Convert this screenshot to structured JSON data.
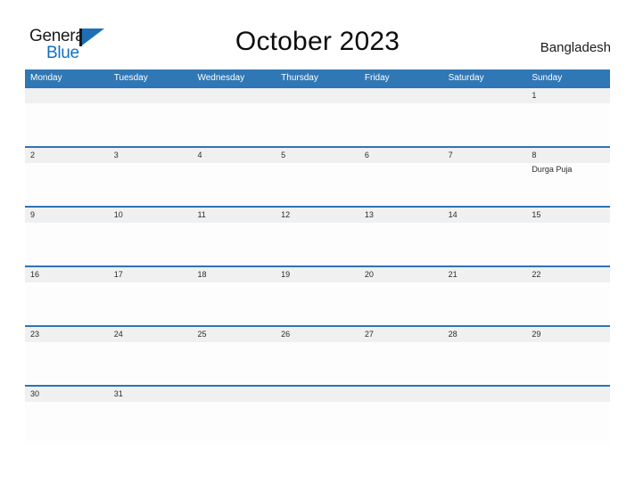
{
  "brand": {
    "name_top": "General",
    "name_bottom": "Blue",
    "accent_color": "#1f6fb5",
    "text_color": "#1b1b1b",
    "blue_text_color": "#1270c0"
  },
  "header": {
    "title": "October 2023",
    "country": "Bangladesh"
  },
  "colors": {
    "header_blue": "#3077b5",
    "row_divider_blue": "#2e74b5",
    "day_band_gray": "#f0f0f0",
    "page_background": "#ffffff",
    "cell_background": "#fdfdfd"
  },
  "calendar": {
    "month": "October",
    "year": "2023",
    "weekday_headers": [
      "Monday",
      "Tuesday",
      "Wednesday",
      "Thursday",
      "Friday",
      "Saturday",
      "Sunday"
    ],
    "weeks": [
      {
        "days": [
          {
            "num": "",
            "event": ""
          },
          {
            "num": "",
            "event": ""
          },
          {
            "num": "",
            "event": ""
          },
          {
            "num": "",
            "event": ""
          },
          {
            "num": "",
            "event": ""
          },
          {
            "num": "",
            "event": ""
          },
          {
            "num": "1",
            "event": ""
          }
        ]
      },
      {
        "days": [
          {
            "num": "2",
            "event": ""
          },
          {
            "num": "3",
            "event": ""
          },
          {
            "num": "4",
            "event": ""
          },
          {
            "num": "5",
            "event": ""
          },
          {
            "num": "6",
            "event": ""
          },
          {
            "num": "7",
            "event": ""
          },
          {
            "num": "8",
            "event": "Durga Puja"
          }
        ]
      },
      {
        "days": [
          {
            "num": "9",
            "event": ""
          },
          {
            "num": "10",
            "event": ""
          },
          {
            "num": "11",
            "event": ""
          },
          {
            "num": "12",
            "event": ""
          },
          {
            "num": "13",
            "event": ""
          },
          {
            "num": "14",
            "event": ""
          },
          {
            "num": "15",
            "event": ""
          }
        ]
      },
      {
        "days": [
          {
            "num": "16",
            "event": ""
          },
          {
            "num": "17",
            "event": ""
          },
          {
            "num": "18",
            "event": ""
          },
          {
            "num": "19",
            "event": ""
          },
          {
            "num": "20",
            "event": ""
          },
          {
            "num": "21",
            "event": ""
          },
          {
            "num": "22",
            "event": ""
          }
        ]
      },
      {
        "days": [
          {
            "num": "23",
            "event": ""
          },
          {
            "num": "24",
            "event": ""
          },
          {
            "num": "25",
            "event": ""
          },
          {
            "num": "26",
            "event": ""
          },
          {
            "num": "27",
            "event": ""
          },
          {
            "num": "28",
            "event": ""
          },
          {
            "num": "29",
            "event": ""
          }
        ]
      },
      {
        "days": [
          {
            "num": "30",
            "event": ""
          },
          {
            "num": "31",
            "event": ""
          },
          {
            "num": "",
            "event": ""
          },
          {
            "num": "",
            "event": ""
          },
          {
            "num": "",
            "event": ""
          },
          {
            "num": "",
            "event": ""
          },
          {
            "num": "",
            "event": ""
          }
        ]
      }
    ]
  }
}
